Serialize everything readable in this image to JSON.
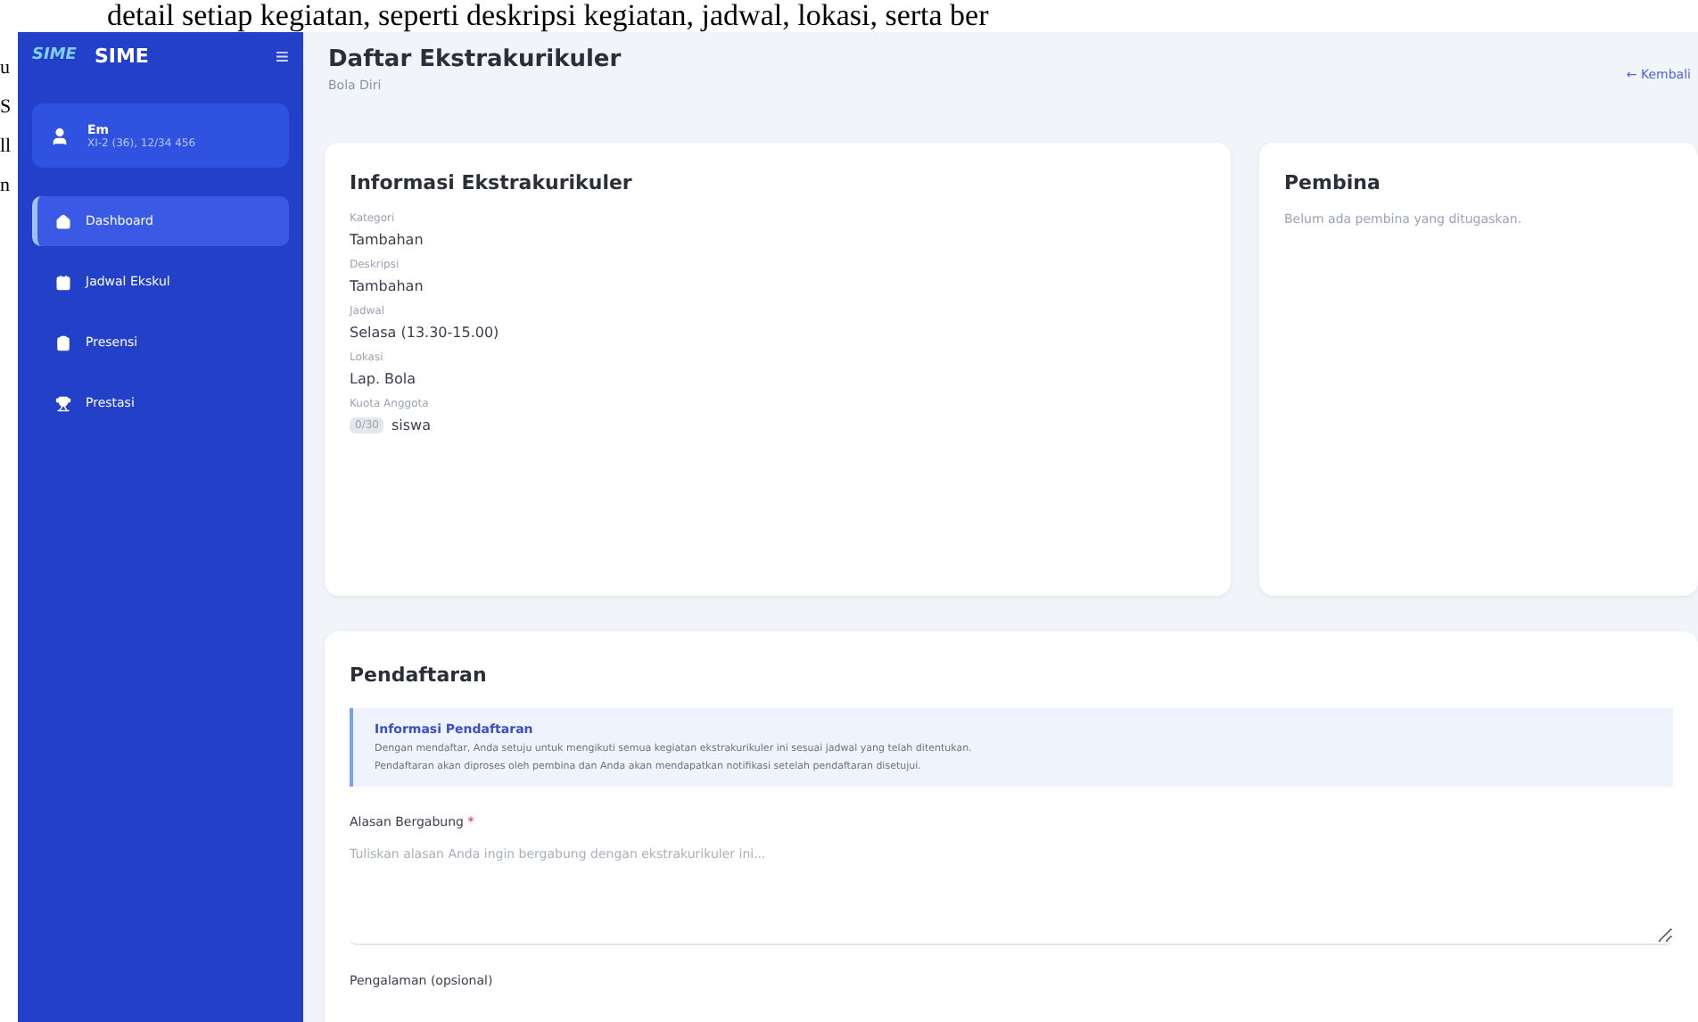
{
  "document_text": {
    "top_line": "detail setiap kegiatan, seperti deskripsi kegiatan, jadwal, lokasi, serta ber",
    "margin_fragments": [
      "u",
      "S",
      "ll",
      "n"
    ]
  },
  "sidebar": {
    "logo": "SIME",
    "brand": "SIME",
    "menu_toggle": "≡",
    "user": {
      "name": "Em",
      "subtitle": "XI-2 (36), 12/34 456"
    },
    "items": [
      {
        "label": "Dashboard",
        "selected": true
      },
      {
        "label": "Jadwal Ekskul",
        "selected": false
      },
      {
        "label": "Presensi",
        "selected": false
      },
      {
        "label": "Prestasi",
        "selected": false
      }
    ]
  },
  "header": {
    "title": "Daftar Ekstrakurikuler",
    "subtitle": "Bola Diri",
    "back_link": "← Kembali"
  },
  "info_card": {
    "title": "Informasi Ekstrakurikuler",
    "fields": [
      {
        "label": "Kategori",
        "value": "Tambahan"
      },
      {
        "label": "Deskripsi",
        "value": "Tambahan"
      },
      {
        "label": "Jadwal",
        "value": "Selasa (13.30-15.00)"
      },
      {
        "label": "Lokasi",
        "value": "Lap. Bola"
      },
      {
        "label": "Kuota Anggota",
        "value": "siswa",
        "badge": "0/30"
      }
    ]
  },
  "pembina_card": {
    "title": "Pembina",
    "empty_text": "Belum ada pembina yang ditugaskan."
  },
  "registration": {
    "title": "Pendaftaran",
    "notice": {
      "title": "Informasi Pendaftaran",
      "lines": [
        "Dengan mendaftar, Anda setuju untuk mengikuti semua kegiatan ekstrakurikuler ini sesuai jadwal yang telah ditentukan.",
        "Pendaftaran akan diproses oleh pembina dan Anda akan mendapatkan notifikasi setelah pendaftaran disetujui."
      ]
    },
    "reason_field": {
      "label": "Alasan Bergabung",
      "required_mark": "*",
      "placeholder": "Tuliskan alasan Anda ingin bergabung dengan ekstrakurikuler ini..."
    },
    "experience_label": "Pengalaman (opsional)"
  }
}
